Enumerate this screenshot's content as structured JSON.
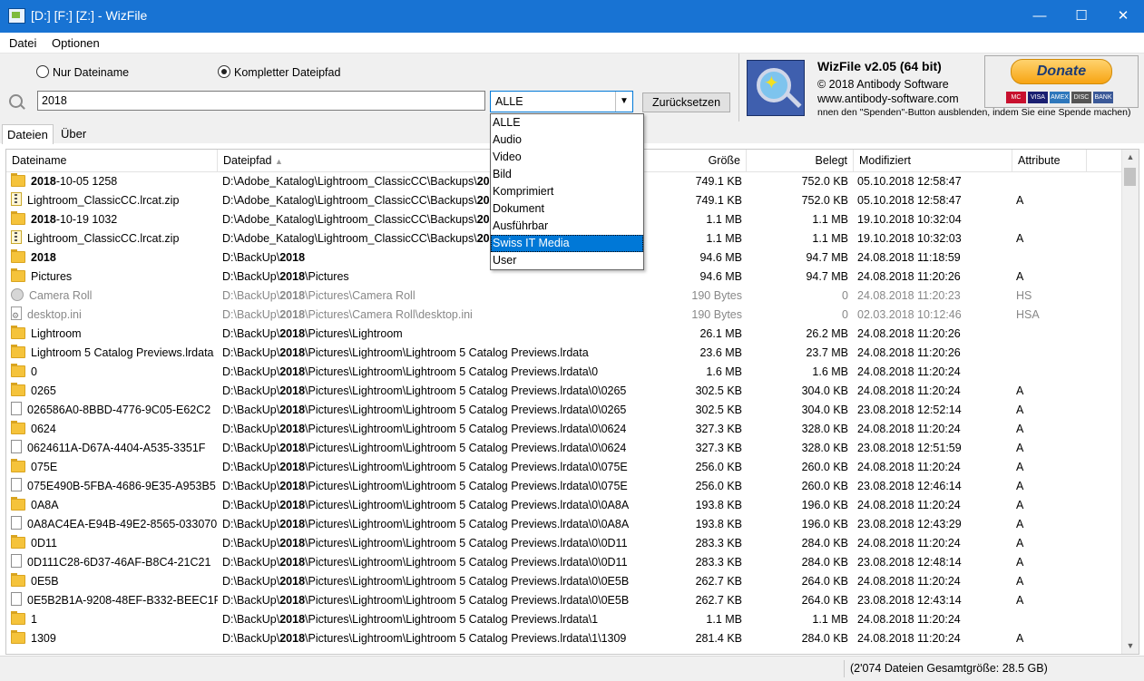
{
  "window": {
    "title": "[D:] [F:] [Z:]  - WizFile",
    "minimize": "—",
    "maximize": "☐",
    "close": "✕"
  },
  "menu": [
    "Datei",
    "Optionen"
  ],
  "search": {
    "radio_name": "Nur Dateiname",
    "radio_path": "Kompletter Dateipfad",
    "selected_radio": "Kompletter Dateipfad",
    "value": "2018",
    "filter_value": "ALLE",
    "reset_label": "Zurücksetzen"
  },
  "info": {
    "app_name": "WizFile v2.05 (64 bit)",
    "copyright": "© 2018 Antibody Software",
    "website": "www.antibody-software.com",
    "note": "nnen den \"Spenden\"-Button ausblenden, indem Sie eine Spende machen)",
    "donate_label": "Donate",
    "cards": [
      "MC",
      "VISA",
      "AMEX",
      "DISC",
      "BANK"
    ]
  },
  "tabs": [
    "Dateien",
    "Über"
  ],
  "columns": {
    "name": "Dateiname",
    "path": "Dateipfad",
    "size": "Größe",
    "used": "Belegt",
    "modified": "Modifiziert",
    "attrs": "Attribute"
  },
  "dropdown": {
    "options": [
      "ALLE",
      "Audio",
      "Video",
      "Bild",
      "Komprimiert",
      "Dokument",
      "Ausführbar",
      "Swiss IT Media",
      "User"
    ],
    "highlighted": "Swiss IT Media"
  },
  "rows": [
    {
      "icon": "folder",
      "nb": "2018",
      "na": "-10-05 1258",
      "p1": "D:\\Adobe_Katalog\\Lightroom_ClassicCC\\Backups\\",
      "pb": "20",
      "p2": "",
      "size": "749.1 KB",
      "used": "752.0 KB",
      "mod": "05.10.2018 12:58:47",
      "attr": ""
    },
    {
      "icon": "zip",
      "nb": "",
      "na": "Lightroom_ClassicCC.lrcat.zip",
      "p1": "D:\\Adobe_Katalog\\Lightroom_ClassicCC\\Backups\\",
      "pb": "20",
      "p2": "",
      "size": "749.1 KB",
      "used": "752.0 KB",
      "mod": "05.10.2018 12:58:47",
      "attr": "A"
    },
    {
      "icon": "folder",
      "nb": "2018",
      "na": "-10-19 1032",
      "p1": "D:\\Adobe_Katalog\\Lightroom_ClassicCC\\Backups\\",
      "pb": "20",
      "p2": "",
      "size": "1.1 MB",
      "used": "1.1 MB",
      "mod": "19.10.2018 10:32:04",
      "attr": ""
    },
    {
      "icon": "zip",
      "nb": "",
      "na": "Lightroom_ClassicCC.lrcat.zip",
      "p1": "D:\\Adobe_Katalog\\Lightroom_ClassicCC\\Backups\\",
      "pb": "20",
      "p2": "",
      "size": "1.1 MB",
      "used": "1.1 MB",
      "mod": "19.10.2018 10:32:03",
      "attr": "A"
    },
    {
      "icon": "folder",
      "nb": "2018",
      "na": "",
      "p1": "D:\\BackUp\\",
      "pb": "2018",
      "p2": "",
      "size": "94.6 MB",
      "used": "94.7 MB",
      "mod": "24.08.2018 11:18:59",
      "attr": ""
    },
    {
      "icon": "folder",
      "nb": "",
      "na": "Pictures",
      "p1": "D:\\BackUp\\",
      "pb": "2018",
      "p2": "\\Pictures",
      "size": "94.6 MB",
      "used": "94.7 MB",
      "mod": "24.08.2018 11:20:26",
      "attr": "A"
    },
    {
      "icon": "gear",
      "gray": true,
      "nb": "",
      "na": "Camera Roll",
      "p1": "D:\\BackUp\\",
      "pb": "2018",
      "p2": "\\Pictures\\Camera Roll",
      "size": "190 Bytes",
      "used": "0",
      "mod": "24.08.2018 11:20:23",
      "attr": "HS"
    },
    {
      "icon": "ini",
      "gray": true,
      "nb": "",
      "na": "desktop.ini",
      "p1": "D:\\BackUp\\",
      "pb": "2018",
      "p2": "\\Pictures\\Camera Roll\\desktop.ini",
      "size": "190 Bytes",
      "used": "0",
      "mod": "02.03.2018 10:12:46",
      "attr": "HSA"
    },
    {
      "icon": "folder",
      "nb": "",
      "na": "Lightroom",
      "p1": "D:\\BackUp\\",
      "pb": "2018",
      "p2": "\\Pictures\\Lightroom",
      "size": "26.1 MB",
      "used": "26.2 MB",
      "mod": "24.08.2018 11:20:26",
      "attr": ""
    },
    {
      "icon": "folder",
      "nb": "",
      "na": "Lightroom 5 Catalog Previews.lrdata",
      "p1": "D:\\BackUp\\",
      "pb": "2018",
      "p2": "\\Pictures\\Lightroom\\Lightroom 5 Catalog Previews.lrdata",
      "size": "23.6 MB",
      "used": "23.7 MB",
      "mod": "24.08.2018 11:20:26",
      "attr": ""
    },
    {
      "icon": "folder",
      "nb": "",
      "na": "0",
      "p1": "D:\\BackUp\\",
      "pb": "2018",
      "p2": "\\Pictures\\Lightroom\\Lightroom 5 Catalog Previews.lrdata\\0",
      "size": "1.6 MB",
      "used": "1.6 MB",
      "mod": "24.08.2018 11:20:24",
      "attr": ""
    },
    {
      "icon": "folder",
      "nb": "",
      "na": "0265",
      "p1": "D:\\BackUp\\",
      "pb": "2018",
      "p2": "\\Pictures\\Lightroom\\Lightroom 5 Catalog Previews.lrdata\\0\\0265",
      "size": "302.5 KB",
      "used": "304.0 KB",
      "mod": "24.08.2018 11:20:24",
      "attr": "A"
    },
    {
      "icon": "file",
      "nb": "",
      "na": "026586A0-8BBD-4776-9C05-E62C2",
      "p1": "D:\\BackUp\\",
      "pb": "2018",
      "p2": "\\Pictures\\Lightroom\\Lightroom 5 Catalog Previews.lrdata\\0\\0265",
      "size": "302.5 KB",
      "used": "304.0 KB",
      "mod": "23.08.2018 12:52:14",
      "attr": "A"
    },
    {
      "icon": "folder",
      "nb": "",
      "na": "0624",
      "p1": "D:\\BackUp\\",
      "pb": "2018",
      "p2": "\\Pictures\\Lightroom\\Lightroom 5 Catalog Previews.lrdata\\0\\0624",
      "size": "327.3 KB",
      "used": "328.0 KB",
      "mod": "24.08.2018 11:20:24",
      "attr": "A"
    },
    {
      "icon": "file",
      "nb": "",
      "na": "0624611A-D67A-4404-A535-3351F",
      "p1": "D:\\BackUp\\",
      "pb": "2018",
      "p2": "\\Pictures\\Lightroom\\Lightroom 5 Catalog Previews.lrdata\\0\\0624",
      "size": "327.3 KB",
      "used": "328.0 KB",
      "mod": "23.08.2018 12:51:59",
      "attr": "A"
    },
    {
      "icon": "folder",
      "nb": "",
      "na": "075E",
      "p1": "D:\\BackUp\\",
      "pb": "2018",
      "p2": "\\Pictures\\Lightroom\\Lightroom 5 Catalog Previews.lrdata\\0\\075E",
      "size": "256.0 KB",
      "used": "260.0 KB",
      "mod": "24.08.2018 11:20:24",
      "attr": "A"
    },
    {
      "icon": "file",
      "nb": "",
      "na": "075E490B-5FBA-4686-9E35-A953B5",
      "p1": "D:\\BackUp\\",
      "pb": "2018",
      "p2": "\\Pictures\\Lightroom\\Lightroom 5 Catalog Previews.lrdata\\0\\075E",
      "size": "256.0 KB",
      "used": "260.0 KB",
      "mod": "23.08.2018 12:46:14",
      "attr": "A"
    },
    {
      "icon": "folder",
      "nb": "",
      "na": "0A8A",
      "p1": "D:\\BackUp\\",
      "pb": "2018",
      "p2": "\\Pictures\\Lightroom\\Lightroom 5 Catalog Previews.lrdata\\0\\0A8A",
      "size": "193.8 KB",
      "used": "196.0 KB",
      "mod": "24.08.2018 11:20:24",
      "attr": "A"
    },
    {
      "icon": "file",
      "nb": "",
      "na": "0A8AC4EA-E94B-49E2-8565-033070",
      "p1": "D:\\BackUp\\",
      "pb": "2018",
      "p2": "\\Pictures\\Lightroom\\Lightroom 5 Catalog Previews.lrdata\\0\\0A8A",
      "size": "193.8 KB",
      "used": "196.0 KB",
      "mod": "23.08.2018 12:43:29",
      "attr": "A"
    },
    {
      "icon": "folder",
      "nb": "",
      "na": "0D11",
      "p1": "D:\\BackUp\\",
      "pb": "2018",
      "p2": "\\Pictures\\Lightroom\\Lightroom 5 Catalog Previews.lrdata\\0\\0D11",
      "size": "283.3 KB",
      "used": "284.0 KB",
      "mod": "24.08.2018 11:20:24",
      "attr": "A"
    },
    {
      "icon": "file",
      "nb": "",
      "na": "0D111C28-6D37-46AF-B8C4-21C21",
      "p1": "D:\\BackUp\\",
      "pb": "2018",
      "p2": "\\Pictures\\Lightroom\\Lightroom 5 Catalog Previews.lrdata\\0\\0D11",
      "size": "283.3 KB",
      "used": "284.0 KB",
      "mod": "23.08.2018 12:48:14",
      "attr": "A"
    },
    {
      "icon": "folder",
      "nb": "",
      "na": "0E5B",
      "p1": "D:\\BackUp\\",
      "pb": "2018",
      "p2": "\\Pictures\\Lightroom\\Lightroom 5 Catalog Previews.lrdata\\0\\0E5B",
      "size": "262.7 KB",
      "used": "264.0 KB",
      "mod": "24.08.2018 11:20:24",
      "attr": "A"
    },
    {
      "icon": "file",
      "nb": "",
      "na": "0E5B2B1A-9208-48EF-B332-BEEC1F",
      "p1": "D:\\BackUp\\",
      "pb": "2018",
      "p2": "\\Pictures\\Lightroom\\Lightroom 5 Catalog Previews.lrdata\\0\\0E5B",
      "size": "262.7 KB",
      "used": "264.0 KB",
      "mod": "23.08.2018 12:43:14",
      "attr": "A"
    },
    {
      "icon": "folder",
      "nb": "",
      "na": "1",
      "p1": "D:\\BackUp\\",
      "pb": "2018",
      "p2": "\\Pictures\\Lightroom\\Lightroom 5 Catalog Previews.lrdata\\1",
      "size": "1.1 MB",
      "used": "1.1 MB",
      "mod": "24.08.2018 11:20:24",
      "attr": ""
    },
    {
      "icon": "folder",
      "nb": "",
      "na": "1309",
      "p1": "D:\\BackUp\\",
      "pb": "2018",
      "p2": "\\Pictures\\Lightroom\\Lightroom 5 Catalog Previews.lrdata\\1\\1309",
      "size": "281.4 KB",
      "used": "284.0 KB",
      "mod": "24.08.2018 11:20:24",
      "attr": "A"
    }
  ],
  "status": "(2'074 Dateien  Gesamtgröße: 28.5 GB)"
}
